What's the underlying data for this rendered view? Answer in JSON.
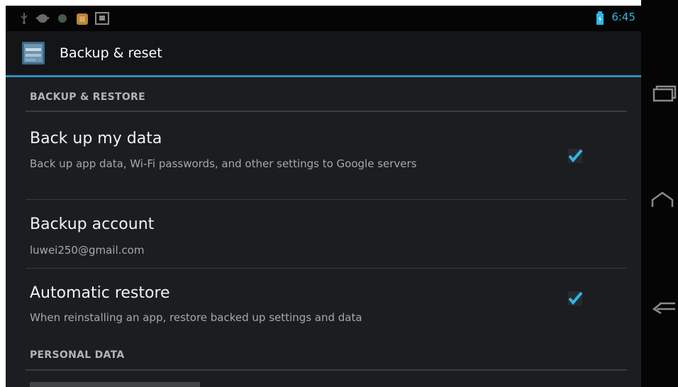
{
  "status_bar": {
    "time": "6:45",
    "icons": [
      "usb-icon",
      "android-debug-icon",
      "sync-icon",
      "package-icon",
      "image-icon",
      "battery-icon"
    ]
  },
  "action_bar": {
    "title": "Backup & reset",
    "icon": "backup-settings-icon"
  },
  "sections": [
    {
      "header": "BACKUP & RESTORE",
      "items": [
        {
          "title": "Back up my data",
          "summary": "Back up app data, Wi-Fi passwords, and other settings to Google servers",
          "checked": true
        },
        {
          "title": "Backup account",
          "summary": "luwei250@gmail.com"
        },
        {
          "title": "Automatic restore",
          "summary": "When reinstalling an app, restore backed up settings and data",
          "checked": true
        }
      ]
    },
    {
      "header": "PERSONAL DATA",
      "items": []
    }
  ],
  "nav_bar": {
    "buttons": [
      "recent-apps-icon",
      "home-icon",
      "back-icon"
    ]
  },
  "colors": {
    "accent": "#33b5e5",
    "background": "#1b1d20"
  }
}
